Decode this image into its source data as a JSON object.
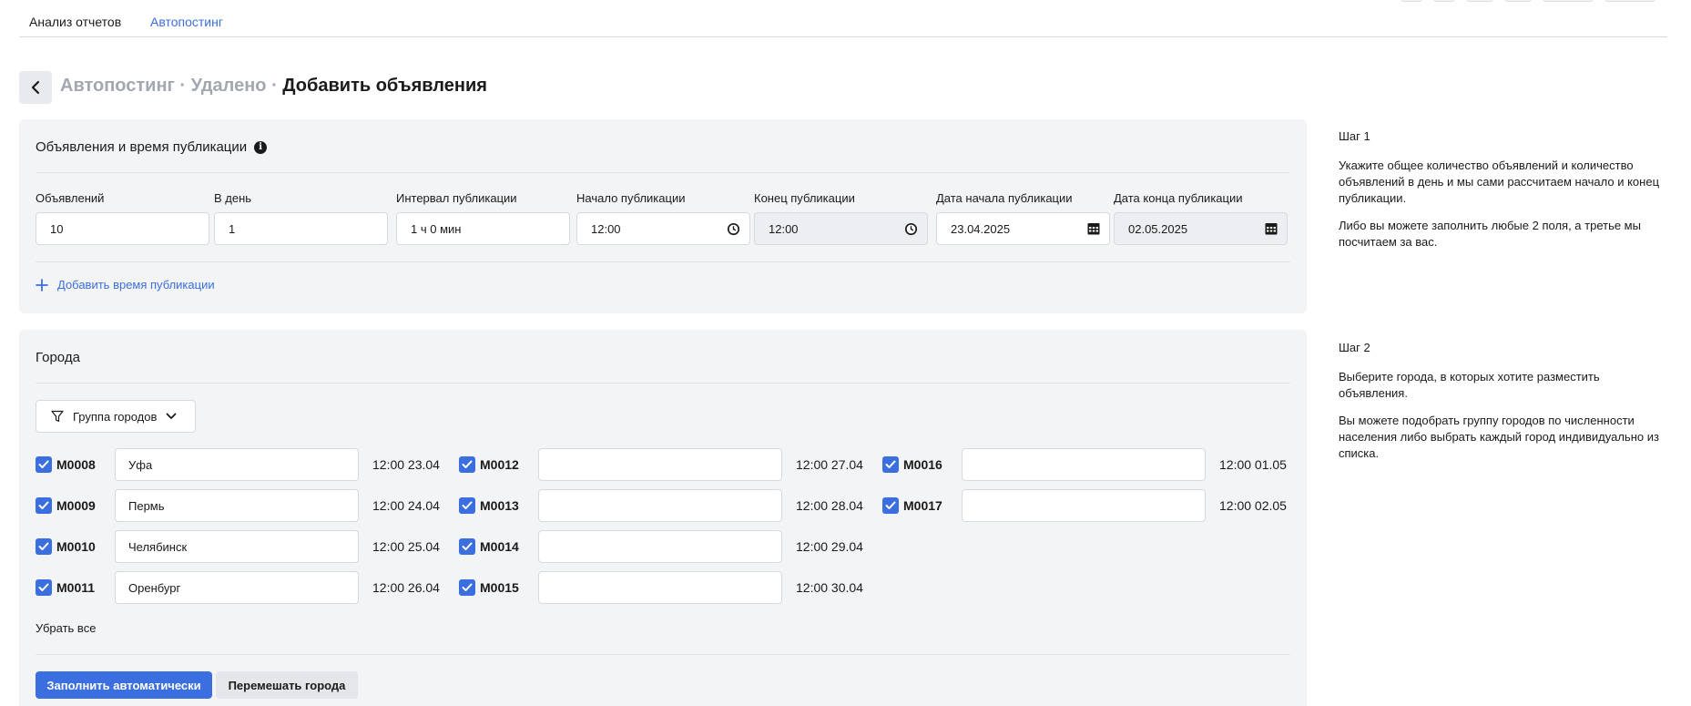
{
  "top_tabs": [
    "Анализ отчетов",
    "Автопостинг"
  ],
  "breadcrumb": {
    "part1": "Автопостинг · ",
    "part2": "Удалено · ",
    "current": "Добавить объявления"
  },
  "publication": {
    "title": "Объявления и время публикации",
    "labels": {
      "count": "Объявлений",
      "per_day": "В день",
      "interval": "Интервал публикации",
      "start": "Начало публикации",
      "end": "Конец публикации",
      "start_date": "Дата начала публикации",
      "end_date": "Дата конца публикации"
    },
    "values": {
      "count": "10",
      "per_day": "1",
      "interval": "1 ч 0 мин",
      "start": "12:00",
      "end": "12:00",
      "start_date": "23.04.2025",
      "end_date": "02.05.2025"
    },
    "add_time_label": "Добавить время публикации"
  },
  "cities": {
    "title": "Города",
    "group_button": "Группа городов",
    "columns": [
      [
        {
          "code": "M0008",
          "city": "Уфа",
          "time": "12:00 23.04"
        },
        {
          "code": "M0009",
          "city": "Пермь",
          "time": "12:00 24.04"
        },
        {
          "code": "M0010",
          "city": "Челябинск",
          "time": "12:00 25.04"
        },
        {
          "code": "M0011",
          "city": "Оренбург",
          "time": "12:00 26.04"
        }
      ],
      [
        {
          "code": "M0012",
          "city": "",
          "time": "12:00 27.04"
        },
        {
          "code": "M0013",
          "city": "",
          "time": "12:00 28.04"
        },
        {
          "code": "M0014",
          "city": "",
          "time": "12:00 29.04"
        },
        {
          "code": "M0015",
          "city": "",
          "time": "12:00 30.04"
        }
      ],
      [
        {
          "code": "M0016",
          "city": "",
          "time": "12:00 01.05"
        },
        {
          "code": "M0017",
          "city": "",
          "time": "12:00 02.05"
        }
      ]
    ],
    "remove_all": "Убрать все",
    "fill_auto": "Заполнить автоматически",
    "shuffle": "Перемешать города"
  },
  "help": {
    "step1": {
      "title": "Шаг 1",
      "p1": "Укажите общее количество объявлений и количество объявлений в день и мы сами рассчитаем начало и конец публикации.",
      "p2": "Либо вы можете заполнить любые 2 поля, а третье мы посчитаем за вас."
    },
    "step2": {
      "title": "Шаг 2",
      "p1": "Выберите города, в которых хотите разместить объявления.",
      "p2": "Вы можете подобрать группу городов по численности населения либо выбрать каждый город индивидуально из списка."
    }
  },
  "colors": {
    "accent": "#3b6fdf",
    "panel": "#f3f4f6"
  },
  "icons": [
    "chevron-left-icon",
    "info-icon",
    "clock-icon",
    "calendar-icon",
    "plus-icon",
    "filter-icon",
    "chevron-down-icon",
    "checkbox-checked-icon"
  ]
}
